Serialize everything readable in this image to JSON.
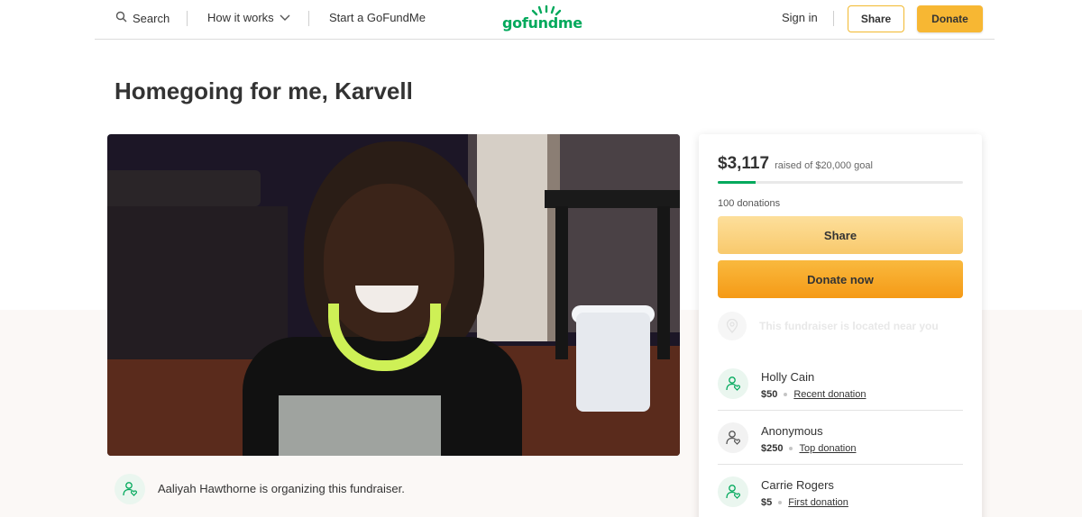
{
  "header": {
    "search_label": "Search",
    "how_it_works_label": "How it works",
    "start_label": "Start a GoFundMe",
    "logo_text": "gofundme",
    "sign_in_label": "Sign in",
    "share_label": "Share",
    "donate_label": "Donate"
  },
  "campaign": {
    "title": "Homegoing for me, Karvell",
    "organizer_text": "Aaliyah Hawthorne is organizing this fundraiser."
  },
  "donate_card": {
    "raised_amount": "$3,117",
    "raised_goal_text": "raised of $20,000 goal",
    "progress_fraction": 0.156,
    "donations_count": "100 donations",
    "share_label": "Share",
    "donate_now_label": "Donate now",
    "location_text": "This fundraiser is located near you",
    "donors": [
      {
        "name": "Holly Cain",
        "amount": "$50",
        "tag": "Recent donation"
      },
      {
        "name": "Anonymous",
        "amount": "$250",
        "tag": "Top donation"
      },
      {
        "name": "Carrie Rogers",
        "amount": "$5",
        "tag": "First donation"
      }
    ]
  },
  "colors": {
    "brand_green": "#02a95c",
    "donate_yellow": "#f7b733",
    "donate_orange": "#f59a16"
  }
}
